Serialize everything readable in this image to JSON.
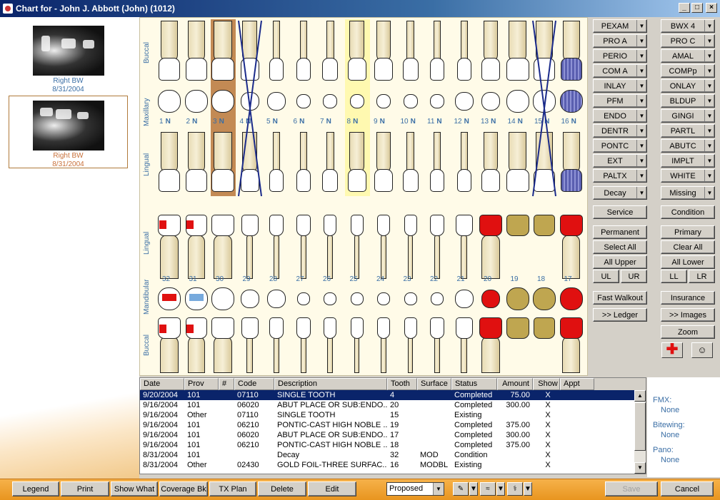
{
  "window": {
    "title": "Chart for - John J. Abbott (John) (1012)"
  },
  "images": [
    {
      "label": "Right BW",
      "date": "8/31/2004"
    },
    {
      "label": "Right BW",
      "date": "8/31/2004"
    }
  ],
  "chart": {
    "labels": {
      "buccal_top": "Buccal",
      "maxillary": "Maxillary",
      "lingual_top": "Lingual",
      "lingual_bottom": "Lingual",
      "mandibular": "Mandibular",
      "buccal_bottom": "Buccal"
    },
    "upper_numbers": [
      "1",
      "2",
      "3",
      "4",
      "5",
      "6",
      "7",
      "8",
      "9",
      "10",
      "11",
      "12",
      "13",
      "14",
      "15",
      "16"
    ],
    "lower_numbers": [
      "32",
      "31",
      "30",
      "29",
      "28",
      "27",
      "26",
      "25",
      "24",
      "23",
      "22",
      "21",
      "20",
      "19",
      "18",
      "17"
    ],
    "upper_flag": "N"
  },
  "codes_left": [
    "PEXAM",
    "PRO A",
    "PERIO",
    "COM A",
    "INLAY",
    "PFM",
    "ENDO",
    "DENTR",
    "PONTC",
    "EXT",
    "PALTX"
  ],
  "codes_right": [
    "BWX 4",
    "PRO C",
    "AMAL",
    "COMPp",
    "ONLAY",
    "BLDUP",
    "GINGI",
    "PARTL",
    "ABUTC",
    "IMPLT",
    "WHITE"
  ],
  "controls": {
    "decay": "Decay",
    "missing": "Missing",
    "service": "Service",
    "condition": "Condition",
    "permanent": "Permanent",
    "primary": "Primary",
    "select_all": "Select All",
    "clear_all": "Clear All",
    "all_upper": "All Upper",
    "all_lower": "All Lower",
    "ul": "UL",
    "ur": "UR",
    "ll": "LL",
    "lr": "LR",
    "fast_walkout": "Fast Walkout",
    "insurance": "Insurance",
    "ledger": ">> Ledger",
    "images": ">> Images",
    "zoom": "Zoom"
  },
  "table": {
    "headers": [
      "Date",
      "Prov",
      "#",
      "Code",
      "Description",
      "Tooth",
      "Surface",
      "Status",
      "Amount",
      "Show",
      "Appt"
    ],
    "rows": [
      [
        "9/20/2004",
        "101",
        "",
        "07110",
        "SINGLE TOOTH",
        "4",
        "",
        "Completed",
        "75.00",
        "X",
        ""
      ],
      [
        "9/16/2004",
        "101",
        "",
        "06020",
        "ABUT PLACE OR SUB:ENDO...",
        "20",
        "",
        "Completed",
        "300.00",
        "X",
        ""
      ],
      [
        "9/16/2004",
        "Other",
        "",
        "07110",
        "SINGLE TOOTH",
        "15",
        "",
        "Existing",
        "",
        "X",
        ""
      ],
      [
        "9/16/2004",
        "101",
        "",
        "06210",
        "PONTIC-CAST HIGH NOBLE ...",
        "19",
        "",
        "Completed",
        "375.00",
        "X",
        ""
      ],
      [
        "9/16/2004",
        "101",
        "",
        "06020",
        "ABUT PLACE OR SUB:ENDO...",
        "17",
        "",
        "Completed",
        "300.00",
        "X",
        ""
      ],
      [
        "9/16/2004",
        "101",
        "",
        "06210",
        "PONTIC-CAST HIGH NOBLE ...",
        "18",
        "",
        "Completed",
        "375.00",
        "X",
        ""
      ],
      [
        "8/31/2004",
        "101",
        "",
        "",
        "Decay",
        "32",
        "MOD",
        "Condition",
        "",
        "X",
        ""
      ],
      [
        "8/31/2004",
        "Other",
        "",
        "02430",
        "GOLD FOIL-THREE SURFAC...",
        "16",
        "MODBL",
        "Existing",
        "",
        "X",
        ""
      ]
    ]
  },
  "info": {
    "fmx_label": "FMX:",
    "fmx_value": "None",
    "bitewing_label": "Bitewing:",
    "bitewing_value": "None",
    "pano_label": "Pano:",
    "pano_value": "None"
  },
  "bottom": {
    "legend": "Legend",
    "print": "Print",
    "show_what": "Show What",
    "coverage": "Coverage Bk",
    "tx_plan": "TX Plan",
    "delete": "Delete",
    "edit": "Edit",
    "status_select": "Proposed",
    "save": "Save",
    "cancel": "Cancel"
  }
}
